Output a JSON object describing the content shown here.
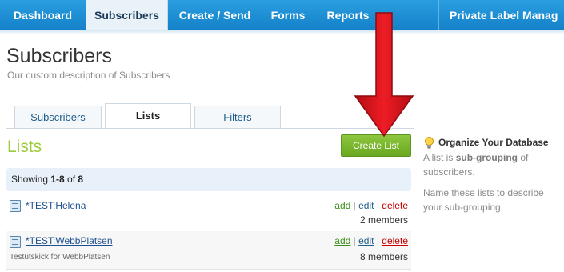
{
  "nav": {
    "items": [
      {
        "label": "Dashboard",
        "active": false
      },
      {
        "label": "Subscribers",
        "active": true
      },
      {
        "label": "Create / Send",
        "active": false
      },
      {
        "label": "Forms",
        "active": false
      },
      {
        "label": "Reports",
        "active": false
      },
      {
        "label": "Private Label Manag",
        "active": false
      }
    ]
  },
  "header": {
    "title": "Subscribers",
    "description": "Our custom description of Subscribers"
  },
  "tabs": [
    {
      "label": "Subscribers",
      "active": false
    },
    {
      "label": "Lists",
      "active": true
    },
    {
      "label": "Filters",
      "active": false
    }
  ],
  "lists": {
    "heading": "Lists",
    "create_label": "Create List",
    "showing": {
      "prefix": "Showing ",
      "range": "1-8",
      "of": " of ",
      "total": "8"
    },
    "rows": [
      {
        "name": "*TEST:Helena",
        "subtext": "",
        "members": "2 members"
      },
      {
        "name": "*TEST:WebbPlatsen",
        "subtext": "Testutskick för WebbPlatsen",
        "members": "8 members"
      }
    ],
    "actions": {
      "add": "add",
      "edit": "edit",
      "delete": "delete",
      "sep": "|"
    }
  },
  "sidebar": {
    "title": "Organize Your Database",
    "p1_a": "A list is ",
    "p1_b": "sub-grouping",
    "p1_c": " of subscribers.",
    "p2": "Name these lists to describe your sub-grouping."
  },
  "colors": {
    "nav": "#1f8fd6",
    "accent_green": "#9ccb3a",
    "button_green": "#7ab62f",
    "arrow_red": "#e0121b"
  },
  "icons": [
    "doc-icon",
    "bulb-icon",
    "red-arrow"
  ]
}
